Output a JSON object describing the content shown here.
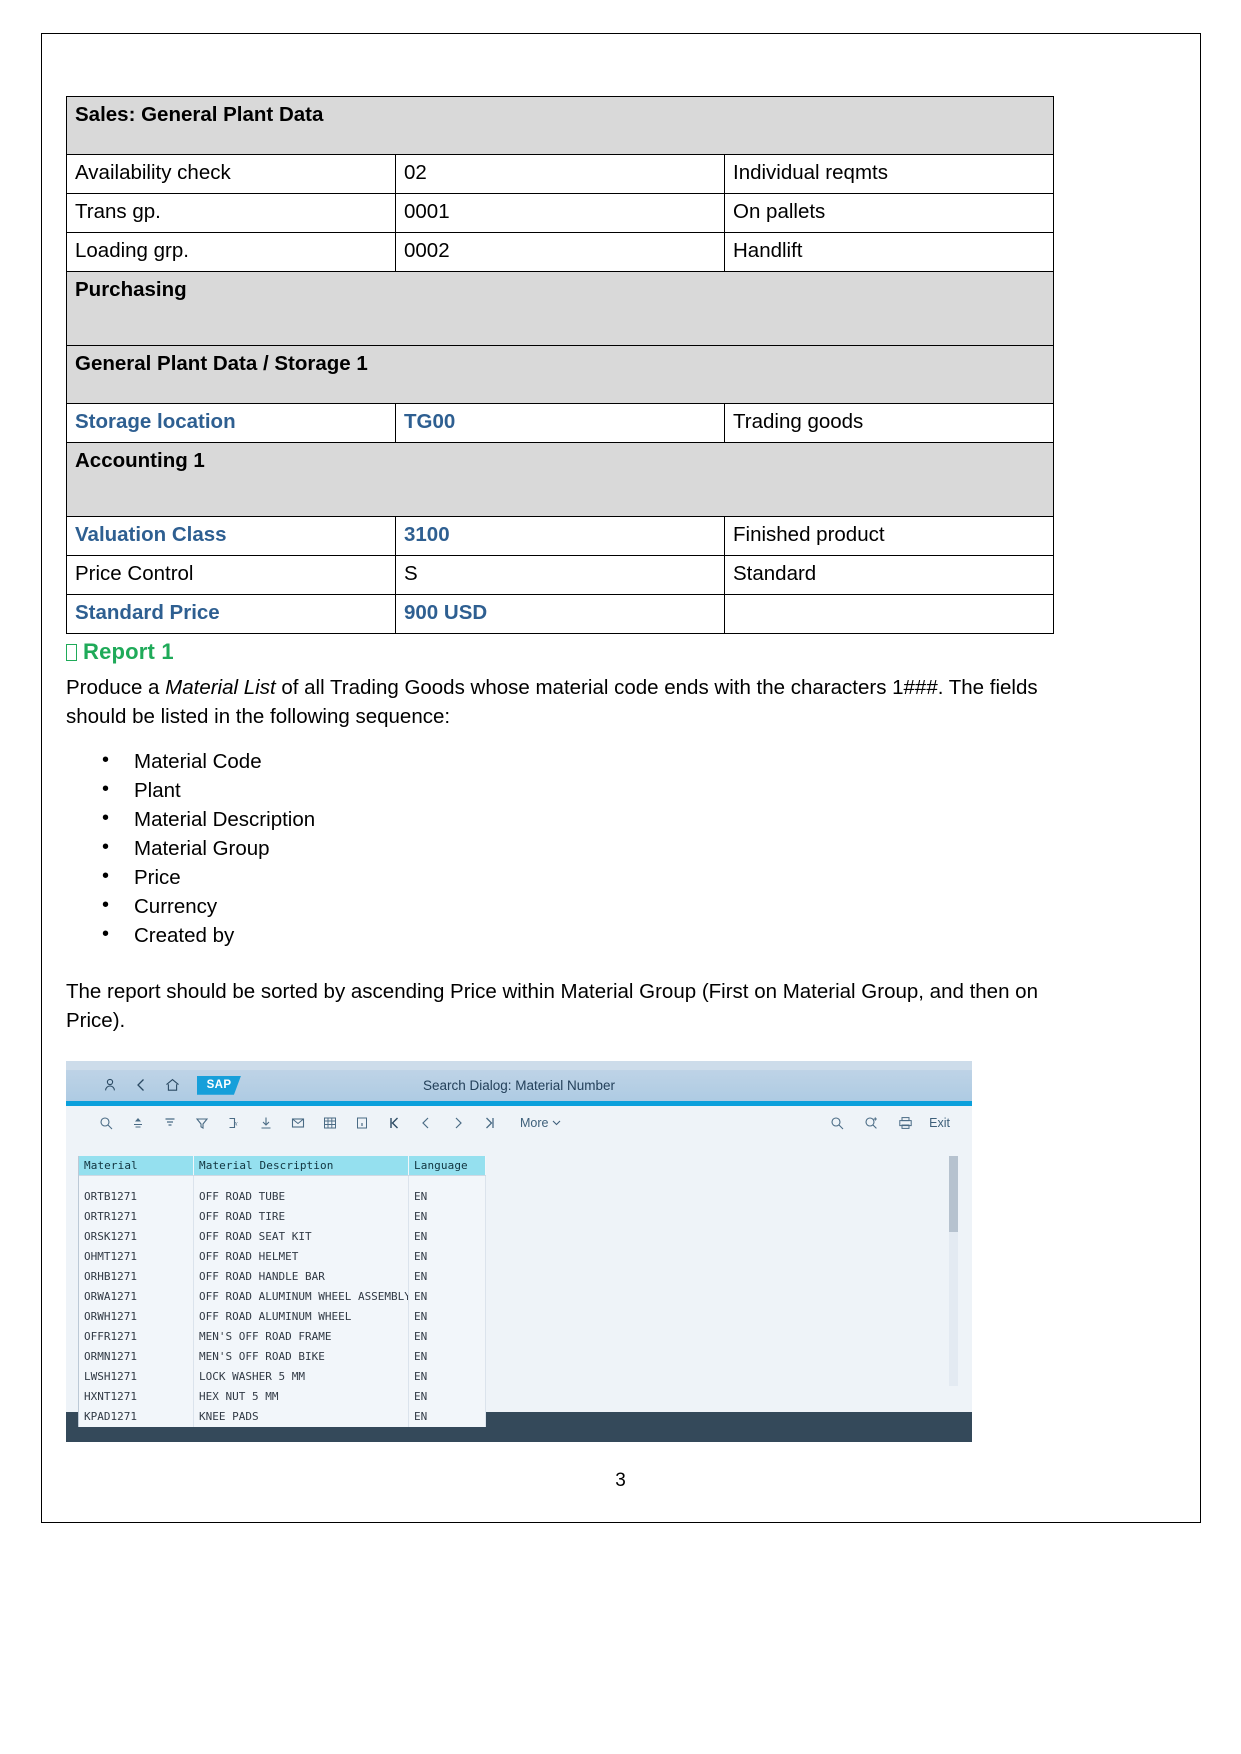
{
  "document": {
    "page_number": "3"
  },
  "material_table": {
    "rows": [
      {
        "type": "section",
        "label": "Sales: General Plant Data"
      },
      {
        "type": "data",
        "label": "Availability check",
        "value": "02",
        "desc": "Individual reqmts",
        "highlight": false
      },
      {
        "type": "data",
        "label": "Trans gp.",
        "value": "0001",
        "desc": "On pallets",
        "highlight": false
      },
      {
        "type": "data",
        "label": "Loading grp.",
        "value": "0002",
        "desc": "Handlift",
        "highlight": false
      },
      {
        "type": "section",
        "label": "Purchasing"
      },
      {
        "type": "section",
        "label": "General Plant Data / Storage 1"
      },
      {
        "type": "data",
        "label": "Storage location",
        "value": "TG00",
        "desc": "Trading goods",
        "highlight": true
      },
      {
        "type": "section",
        "label": "Accounting 1"
      },
      {
        "type": "data",
        "label": "Valuation Class",
        "value": "3100",
        "desc": "Finished product",
        "highlight": true
      },
      {
        "type": "data",
        "label": "Price Control",
        "value": "S",
        "desc": "Standard",
        "highlight": false
      },
      {
        "type": "data",
        "label": "Standard Price",
        "value": "900 USD",
        "desc": "",
        "highlight": true
      }
    ]
  },
  "report": {
    "heading": "Report 1",
    "heading_color": "#1faa59",
    "intro_pre": "Produce a ",
    "intro_italic": "Material List",
    "intro_post": " of all Trading Goods whose material code ends with the characters 1###. The fields should be listed in the following sequence:",
    "fields": [
      "Material Code",
      "Plant",
      "Material Description",
      "Material Group",
      "Price",
      "Currency",
      "Created by"
    ],
    "sort_note": "The report should be sorted by ascending Price within Material Group (First on Material Group, and then on Price)."
  },
  "sap": {
    "title": "Search Dialog: Material Number",
    "logo": "SAP",
    "toolbar": {
      "more_label": "More",
      "exit_label": "Exit",
      "left_icons": [
        "search-magnifier-icon",
        "sort-ascending-icon",
        "sort-descending-icon",
        "filter-icon",
        "formula-icon",
        "download-icon",
        "mail-icon",
        "spreadsheet-icon",
        "info-icon",
        "first-page-icon",
        "previous-page-icon",
        "next-page-icon",
        "last-page-icon"
      ],
      "right_icons": [
        "search-icon",
        "search-plus-icon",
        "print-icon"
      ]
    },
    "grid": {
      "columns": [
        "Material",
        "Material Description",
        "Language"
      ],
      "rows": [
        [
          "ORTB1271",
          "OFF ROAD TUBE",
          "EN"
        ],
        [
          "ORTR1271",
          "OFF ROAD TIRE",
          "EN"
        ],
        [
          "ORSK1271",
          "OFF ROAD SEAT KIT",
          "EN"
        ],
        [
          "OHMT1271",
          "OFF ROAD HELMET",
          "EN"
        ],
        [
          "ORHB1271",
          "OFF ROAD HANDLE BAR",
          "EN"
        ],
        [
          "ORWA1271",
          "OFF ROAD ALUMINUM WHEEL ASSEMBLY",
          "EN"
        ],
        [
          "ORWH1271",
          "OFF ROAD ALUMINUM WHEEL",
          "EN"
        ],
        [
          "OFFR1271",
          "MEN'S OFF ROAD FRAME",
          "EN"
        ],
        [
          "ORMN1271",
          "MEN'S OFF ROAD BIKE",
          "EN"
        ],
        [
          "LWSH1271",
          "LOCK WASHER 5 MM",
          "EN"
        ],
        [
          "HXNT1271",
          "HEX NUT 5 MM",
          "EN"
        ],
        [
          "KPAD1271",
          "KNEE PADS",
          "EN"
        ]
      ]
    }
  }
}
